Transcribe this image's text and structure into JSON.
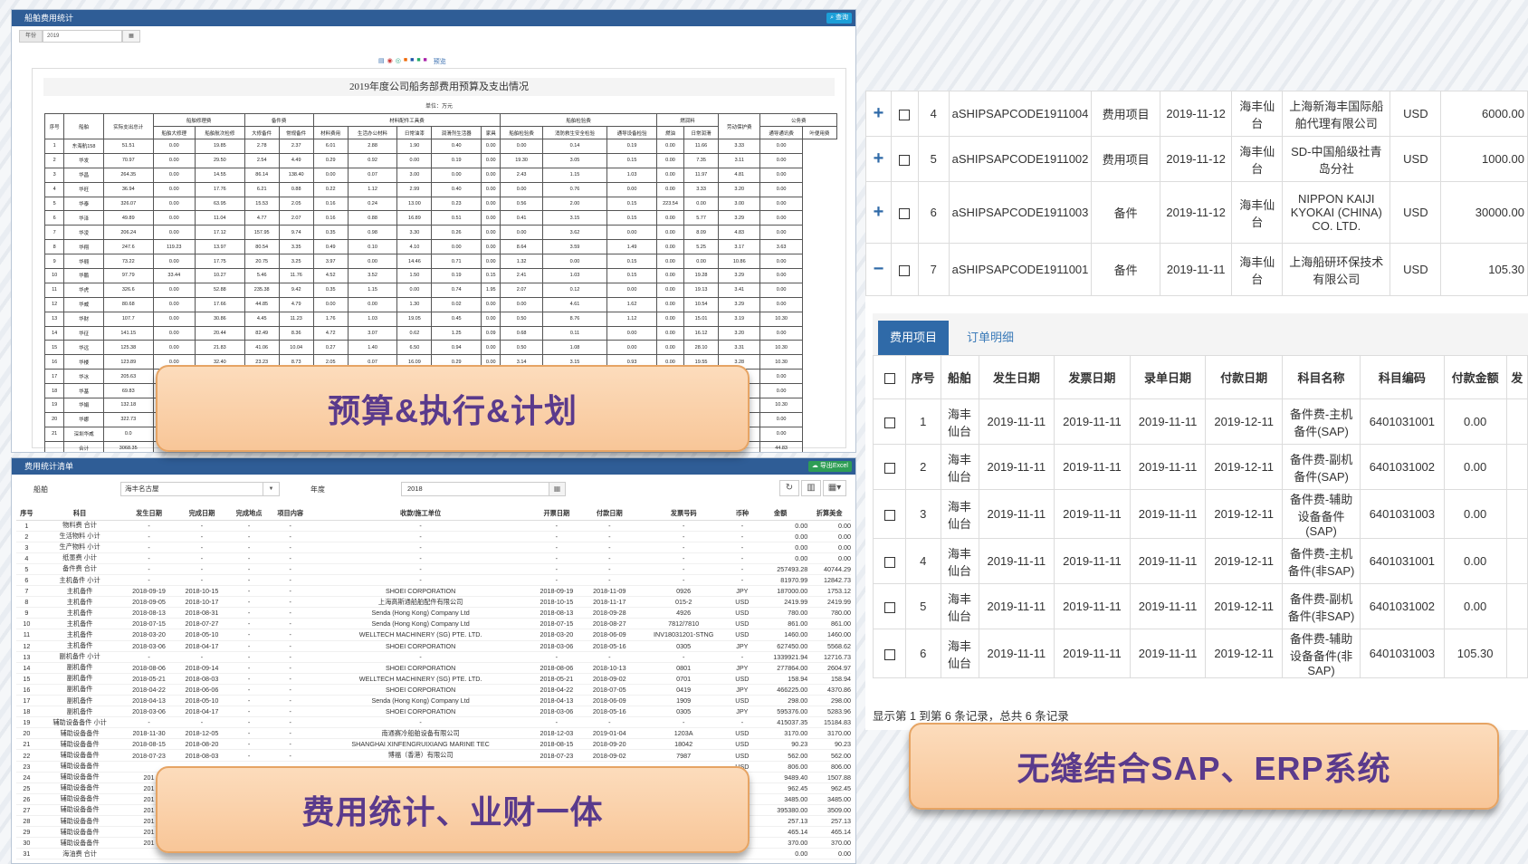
{
  "p1": {
    "title": "船舶费用统计",
    "query_btn": "查询",
    "year_label": "年份",
    "year_value": "2019",
    "toolbar_preview": "预览",
    "report_title": "2019年度公司船务部费用预算及支出情况",
    "unit": "单位：万元",
    "head1": [
      "序号",
      "船舶",
      "实际支出总计",
      "船舶修理费",
      "备件费",
      "材料配件工具费",
      "船舶检验费",
      "燃润料",
      "劳动保护费",
      "公务费"
    ],
    "head2": [
      "船舶大修理",
      "船舶航次检修",
      "大修备件",
      "常规备件",
      "材料费用",
      "生活办公材料",
      "日常油漆",
      "润滑剂生活器",
      "家具",
      "船舶检验费",
      "消防救生安全检验",
      "通导设备检验",
      "燃油",
      "日常润滑",
      "通导通讯费",
      "劳动保护",
      "叶便用费"
    ],
    "rows": [
      [
        "1",
        "东海航158",
        "51.51",
        "0.00",
        "19.85",
        "2.78",
        "2.37",
        "6.01",
        "2.88",
        "1.90",
        "0.40",
        "0.00",
        "0.00",
        "0.14",
        "0.19",
        "0.00",
        "11.66",
        "0.00",
        "3.33",
        "0.00"
      ],
      [
        "2",
        "华发",
        "70.97",
        "0.00",
        "29.50",
        "2.54",
        "4.49",
        "0.29",
        "0.92",
        "0.00",
        "0.19",
        "0.00",
        "19.30",
        "3.05",
        "0.15",
        "0.00",
        "7.35",
        "0.00",
        "3.11",
        "0.00"
      ],
      [
        "3",
        "华昌",
        "264.35",
        "0.00",
        "14.55",
        "86.14",
        "138.40",
        "0.00",
        "0.07",
        "3.00",
        "0.00",
        "0.00",
        "2.43",
        "1.15",
        "1.03",
        "0.00",
        "11.97",
        "0.00",
        "4.81",
        "0.00"
      ],
      [
        "4",
        "华旺",
        "36.94",
        "0.00",
        "17.76",
        "6.21",
        "0.88",
        "0.22",
        "1.12",
        "2.99",
        "0.40",
        "0.00",
        "0.00",
        "0.76",
        "0.00",
        "0.00",
        "3.33",
        "0.00",
        "3.20",
        "0.00"
      ],
      [
        "5",
        "华泰",
        "326.07",
        "0.00",
        "63.95",
        "15.53",
        "2.05",
        "0.16",
        "0.24",
        "13.00",
        "0.23",
        "0.00",
        "0.56",
        "2.00",
        "0.15",
        "223.54",
        "0.00",
        "0.00",
        "3.00",
        "0.00"
      ],
      [
        "6",
        "华泽",
        "49.89",
        "0.00",
        "11.04",
        "4.77",
        "2.07",
        "0.16",
        "0.88",
        "16.89",
        "0.51",
        "0.00",
        "0.41",
        "3.15",
        "0.15",
        "0.00",
        "5.77",
        "0.00",
        "3.29",
        "0.00"
      ],
      [
        "7",
        "华凌",
        "206.24",
        "0.00",
        "17.12",
        "157.95",
        "9.74",
        "0.35",
        "0.98",
        "3.30",
        "0.26",
        "0.00",
        "0.00",
        "3.62",
        "0.00",
        "0.00",
        "8.09",
        "0.00",
        "4.83",
        "0.00"
      ],
      [
        "8",
        "华翔",
        "247.6",
        "119.23",
        "13.97",
        "80.54",
        "3.35",
        "0.49",
        "0.10",
        "4.10",
        "0.00",
        "0.00",
        "8.64",
        "3.59",
        "1.49",
        "0.00",
        "5.25",
        "0.00",
        "3.17",
        "3.63"
      ],
      [
        "9",
        "华翱",
        "73.22",
        "0.00",
        "17.75",
        "20.75",
        "3.25",
        "3.97",
        "0.00",
        "14.46",
        "0.71",
        "0.00",
        "1.32",
        "0.00",
        "0.15",
        "0.00",
        "0.00",
        "0.00",
        "10.86",
        "0.00"
      ],
      [
        "10",
        "华鹏",
        "97.79",
        "33.44",
        "10.27",
        "5.46",
        "11.76",
        "4.52",
        "3.52",
        "1.50",
        "0.19",
        "0.15",
        "2.41",
        "1.03",
        "0.15",
        "0.00",
        "19.28",
        "0.00",
        "3.29",
        "0.00"
      ],
      [
        "11",
        "华虎",
        "326.6",
        "0.00",
        "52.88",
        "235.38",
        "9.42",
        "0.35",
        "1.15",
        "0.00",
        "0.74",
        "1.95",
        "2.07",
        "0.12",
        "0.00",
        "0.00",
        "19.13",
        "0.00",
        "3.41",
        "0.00"
      ],
      [
        "12",
        "华威",
        "80.68",
        "0.00",
        "17.66",
        "44.85",
        "4.79",
        "0.00",
        "0.00",
        "1.30",
        "0.02",
        "0.00",
        "0.00",
        "4.61",
        "1.62",
        "0.00",
        "10.54",
        "0.00",
        "3.29",
        "0.00"
      ],
      [
        "13",
        "华财",
        "107.7",
        "0.00",
        "30.86",
        "4.45",
        "11.23",
        "1.76",
        "1.03",
        "19.05",
        "0.45",
        "0.00",
        "0.50",
        "8.76",
        "1.12",
        "0.00",
        "15.01",
        "0.00",
        "3.19",
        "10.30"
      ],
      [
        "14",
        "华征",
        "141.15",
        "0.00",
        "20.44",
        "82.49",
        "8.36",
        "4.72",
        "3.07",
        "0.62",
        "1.25",
        "0.09",
        "0.68",
        "0.11",
        "0.00",
        "0.00",
        "16.12",
        "0.00",
        "3.20",
        "0.00"
      ],
      [
        "15",
        "华远",
        "125.38",
        "0.00",
        "21.83",
        "41.06",
        "10.04",
        "0.27",
        "1.40",
        "6.50",
        "0.94",
        "0.00",
        "0.50",
        "1.08",
        "0.00",
        "0.00",
        "28.10",
        "0.00",
        "3.31",
        "10.30"
      ],
      [
        "16",
        "华楼",
        "123.89",
        "0.00",
        "32.40",
        "23.23",
        "8.73",
        "2.05",
        "0.07",
        "16.09",
        "0.29",
        "0.00",
        "3.14",
        "3.15",
        "0.93",
        "0.00",
        "19.55",
        "0.00",
        "3.28",
        "10.30"
      ],
      [
        "17",
        "华冰",
        "205.63",
        "",
        "",
        "",
        "",
        "",
        "",
        "",
        "",
        "",
        "",
        "",
        "",
        "",
        "",
        "",
        "3.09",
        "0.00"
      ],
      [
        "18",
        "华基",
        "69.83",
        "",
        "",
        "",
        "",
        "",
        "",
        "",
        "",
        "",
        "",
        "",
        "",
        "",
        "",
        "",
        "3.31",
        "0.00"
      ],
      [
        "19",
        "华娟",
        "132.18",
        "",
        "",
        "",
        "",
        "",
        "",
        "",
        "",
        "",
        "",
        "",
        "",
        "",
        "",
        "",
        "3.28",
        "10.30"
      ],
      [
        "20",
        "华娜",
        "322.73",
        "",
        "",
        "",
        "",
        "",
        "",
        "",
        "",
        "",
        "",
        "",
        "",
        "",
        "",
        "",
        "3.30",
        "0.00"
      ],
      [
        "21",
        "深圳华威",
        "0.0",
        "",
        "",
        "",
        "",
        "",
        "",
        "",
        "",
        "",
        "",
        "",
        "",
        "",
        "",
        "",
        "0.00",
        "0.00"
      ],
      [
        "",
        "合计",
        "3068.35",
        "",
        "",
        "",
        "",
        "",
        "",
        "",
        "",
        "",
        "",
        "",
        "",
        "",
        "",
        "",
        "75.55",
        "44.83"
      ]
    ]
  },
  "p2": {
    "title": "费用统计清单",
    "export_btn": "导出Excel",
    "ship_label": "船舶",
    "ship_value": "海丰名古屋",
    "year_label": "年度",
    "year_value": "2018",
    "cols": [
      "序号",
      "科目",
      "发生日期",
      "完成日期",
      "完成地点",
      "项目内容",
      "收款/施工单位",
      "开票日期",
      "付款日期",
      "发票号码",
      "币种",
      "金额",
      "折算美金"
    ],
    "rows": [
      [
        "1",
        "物料费 合计",
        "-",
        "-",
        "-",
        "-",
        "-",
        "-",
        "-",
        "-",
        "-",
        "0.00",
        "0.00"
      ],
      [
        "2",
        "生活物料 小计",
        "-",
        "-",
        "-",
        "-",
        "-",
        "-",
        "-",
        "-",
        "-",
        "0.00",
        "0.00"
      ],
      [
        "3",
        "生产物料 小计",
        "-",
        "-",
        "-",
        "-",
        "-",
        "-",
        "-",
        "-",
        "-",
        "0.00",
        "0.00"
      ],
      [
        "4",
        "纸墨费 小计",
        "-",
        "-",
        "-",
        "-",
        "-",
        "-",
        "-",
        "-",
        "-",
        "0.00",
        "0.00"
      ],
      [
        "5",
        "备件费 合计",
        "-",
        "-",
        "-",
        "-",
        "-",
        "-",
        "-",
        "-",
        "-",
        "257493.28",
        "40744.29"
      ],
      [
        "6",
        "主机备件 小计",
        "-",
        "-",
        "-",
        "-",
        "-",
        "-",
        "-",
        "-",
        "-",
        "81970.99",
        "12842.73"
      ],
      [
        "7",
        "主机备件",
        "2018-09-19",
        "2018-10-15",
        "-",
        "-",
        "SHOEI CORPORATION",
        "2018-09-19",
        "2018-11-09",
        "0926",
        "JPY",
        "187000.00",
        "1753.12"
      ],
      [
        "8",
        "主机备件",
        "2018-09-05",
        "2018-10-17",
        "-",
        "-",
        "上海高斯通船舶配件有限公司",
        "2018-10-15",
        "2018-11-17",
        "015-2",
        "USD",
        "2419.99",
        "2419.99"
      ],
      [
        "9",
        "主机备件",
        "2018-08-13",
        "2018-08-31",
        "-",
        "-",
        "Senda (Hong Kong) Company Ltd",
        "2018-08-13",
        "2018-09-28",
        "4926",
        "USD",
        "780.00",
        "780.00"
      ],
      [
        "10",
        "主机备件",
        "2018-07-15",
        "2018-07-27",
        "-",
        "-",
        "Senda (Hong Kong) Company Ltd",
        "2018-07-15",
        "2018-08-27",
        "7812/7810",
        "USD",
        "861.00",
        "861.00"
      ],
      [
        "11",
        "主机备件",
        "2018-03-20",
        "2018-05-10",
        "-",
        "-",
        "WELLTECH MACHINERY (SG) PTE. LTD.",
        "2018-03-20",
        "2018-06-09",
        "INV18031201-STNG",
        "USD",
        "1460.00",
        "1460.00"
      ],
      [
        "12",
        "主机备件",
        "2018-03-06",
        "2018-04-17",
        "-",
        "-",
        "SHOEI CORPORATION",
        "2018-03-06",
        "2018-05-16",
        "0305",
        "JPY",
        "627450.00",
        "5568.62"
      ],
      [
        "13",
        "副机备件 小计",
        "-",
        "-",
        "-",
        "-",
        "-",
        "-",
        "-",
        "-",
        "-",
        "1339921.94",
        "12716.73"
      ],
      [
        "14",
        "副机备件",
        "2018-08-06",
        "2018-09-14",
        "-",
        "-",
        "SHOEI CORPORATION",
        "2018-08-06",
        "2018-10-13",
        "0801",
        "JPY",
        "277864.00",
        "2604.97"
      ],
      [
        "15",
        "副机备件",
        "2018-05-21",
        "2018-08-03",
        "-",
        "-",
        "WELLTECH MACHINERY (SG) PTE. LTD.",
        "2018-05-21",
        "2018-09-02",
        "0701",
        "USD",
        "158.94",
        "158.94"
      ],
      [
        "16",
        "副机备件",
        "2018-04-22",
        "2018-06-06",
        "-",
        "-",
        "SHOEI CORPORATION",
        "2018-04-22",
        "2018-07-05",
        "0419",
        "JPY",
        "466225.00",
        "4370.86"
      ],
      [
        "17",
        "副机备件",
        "2018-04-13",
        "2018-05-10",
        "-",
        "-",
        "Senda (Hong Kong) Company Ltd",
        "2018-04-13",
        "2018-06-09",
        "1909",
        "USD",
        "298.00",
        "298.00"
      ],
      [
        "18",
        "副机备件",
        "2018-03-06",
        "2018-04-17",
        "-",
        "-",
        "SHOEI CORPORATION",
        "2018-03-06",
        "2018-05-16",
        "0305",
        "JPY",
        "595376.00",
        "5283.96"
      ],
      [
        "19",
        "辅助设备备件 小计",
        "-",
        "-",
        "-",
        "-",
        "-",
        "-",
        "-",
        "-",
        "-",
        "415037.35",
        "15184.83"
      ],
      [
        "20",
        "辅助设备备件",
        "2018-11-30",
        "2018-12-05",
        "-",
        "-",
        "南通赛冷船舶设备有限公司",
        "2018-12-03",
        "2019-01-04",
        "1203A",
        "USD",
        "3170.00",
        "3170.00"
      ],
      [
        "21",
        "辅助设备备件",
        "2018-08-15",
        "2018-08-20",
        "-",
        "-",
        "SHANGHAI XINFENGRUIXIANG MARINE TEC",
        "2018-08-15",
        "2018-09-20",
        "18042",
        "USD",
        "90.23",
        "90.23"
      ],
      [
        "22",
        "辅助设备备件",
        "2018-07-23",
        "2018-08-03",
        "-",
        "-",
        "博福（香港）有限公司",
        "2018-07-23",
        "2018-09-02",
        "7987",
        "USD",
        "562.00",
        "562.00"
      ],
      [
        "23",
        "辅助设备备件",
        "",
        "",
        "",
        "",
        "",
        "",
        "",
        "",
        "USD",
        "806.00",
        "806.00"
      ],
      [
        "24",
        "辅助设备备件",
        "201",
        "",
        "",
        "",
        "",
        "",
        "",
        "",
        "",
        "9489.40",
        "1507.88"
      ],
      [
        "25",
        "辅助设备备件",
        "201",
        "",
        "",
        "",
        "",
        "",
        "",
        "",
        "",
        "962.45",
        "962.45"
      ],
      [
        "26",
        "辅助设备备件",
        "201",
        "",
        "",
        "",
        "",
        "",
        "",
        "",
        "",
        "3485.00",
        "3485.00"
      ],
      [
        "27",
        "辅助设备备件",
        "201",
        "",
        "",
        "",
        "",
        "",
        "",
        "",
        "",
        "395380.00",
        "3509.00"
      ],
      [
        "28",
        "辅助设备备件",
        "201",
        "",
        "",
        "",
        "",
        "",
        "",
        "",
        "",
        "257.13",
        "257.13"
      ],
      [
        "29",
        "辅助设备备件",
        "201",
        "",
        "",
        "",
        "",
        "",
        "",
        "",
        "",
        "465.14",
        "465.14"
      ],
      [
        "30",
        "辅助设备备件",
        "201",
        "",
        "",
        "",
        "",
        "",
        "",
        "",
        "",
        "370.00",
        "370.00"
      ],
      [
        "31",
        "海油费 合计",
        "",
        "",
        "",
        "",
        "",
        "",
        "",
        "",
        "",
        "0.00",
        "0.00"
      ]
    ]
  },
  "p3": {
    "rows": [
      {
        "sign": "+",
        "no": "4",
        "code": "aSHIPSAPCODE1911004",
        "type": "费用项目",
        "date": "2019-11-12",
        "ship": "海丰仙台",
        "company": "上海新海丰国际船舶代理有限公司",
        "cur": "USD",
        "amount": "6000.00"
      },
      {
        "sign": "+",
        "no": "5",
        "code": "aSHIPSAPCODE1911002",
        "type": "费用项目",
        "date": "2019-11-12",
        "ship": "海丰仙台",
        "company": "SD-中国船级社青岛分社",
        "cur": "USD",
        "amount": "1000.00"
      },
      {
        "sign": "+",
        "no": "6",
        "code": "aSHIPSAPCODE1911003",
        "type": "备件",
        "date": "2019-11-12",
        "ship": "海丰仙台",
        "company": "NIPPON KAIJI KYOKAI (CHINA) CO. LTD.",
        "cur": "USD",
        "amount": "30000.00"
      },
      {
        "sign": "−",
        "no": "7",
        "code": "aSHIPSAPCODE1911001",
        "type": "备件",
        "date": "2019-11-11",
        "ship": "海丰仙台",
        "company": "上海船研环保技术有限公司",
        "cur": "USD",
        "amount": "105.30"
      }
    ],
    "tab_active": "费用项目",
    "tab_other": "订单明细",
    "cols": [
      "序号",
      "船舶",
      "发生日期",
      "发票日期",
      "录单日期",
      "付款日期",
      "科目名称",
      "科目编码",
      "付款金额",
      "发"
    ],
    "detail": [
      {
        "no": "1",
        "ship": "海丰仙台",
        "d1": "2019-11-11",
        "d2": "2019-11-11",
        "d3": "2019-11-11",
        "d4": "2019-12-11",
        "name": "备件费-主机备件(SAP)",
        "code": "6401031001",
        "amt": "0.00"
      },
      {
        "no": "2",
        "ship": "海丰仙台",
        "d1": "2019-11-11",
        "d2": "2019-11-11",
        "d3": "2019-11-11",
        "d4": "2019-12-11",
        "name": "备件费-副机备件(SAP)",
        "code": "6401031002",
        "amt": "0.00"
      },
      {
        "no": "3",
        "ship": "海丰仙台",
        "d1": "2019-11-11",
        "d2": "2019-11-11",
        "d3": "2019-11-11",
        "d4": "2019-12-11",
        "name": "备件费-辅助设备备件(SAP)",
        "code": "6401031003",
        "amt": "0.00"
      },
      {
        "no": "4",
        "ship": "海丰仙台",
        "d1": "2019-11-11",
        "d2": "2019-11-11",
        "d3": "2019-11-11",
        "d4": "2019-12-11",
        "name": "备件费-主机备件(非SAP)",
        "code": "6401031001",
        "amt": "0.00"
      },
      {
        "no": "5",
        "ship": "海丰仙台",
        "d1": "2019-11-11",
        "d2": "2019-11-11",
        "d3": "2019-11-11",
        "d4": "2019-12-11",
        "name": "备件费-副机备件(非SAP)",
        "code": "6401031002",
        "amt": "0.00"
      },
      {
        "no": "6",
        "ship": "海丰仙台",
        "d1": "2019-11-11",
        "d2": "2019-11-11",
        "d3": "2019-11-11",
        "d4": "2019-12-11",
        "name": "备件费-辅助设备备件(非SAP)",
        "code": "6401031003",
        "amt": "105.30"
      }
    ],
    "footer": "显示第 1 到第 6 条记录，总共 6 条记录"
  },
  "callouts": {
    "c1": "预算&执行&计划",
    "c2": "费用统计、业财一体",
    "c3": "无缝结合SAP、ERP系统"
  }
}
